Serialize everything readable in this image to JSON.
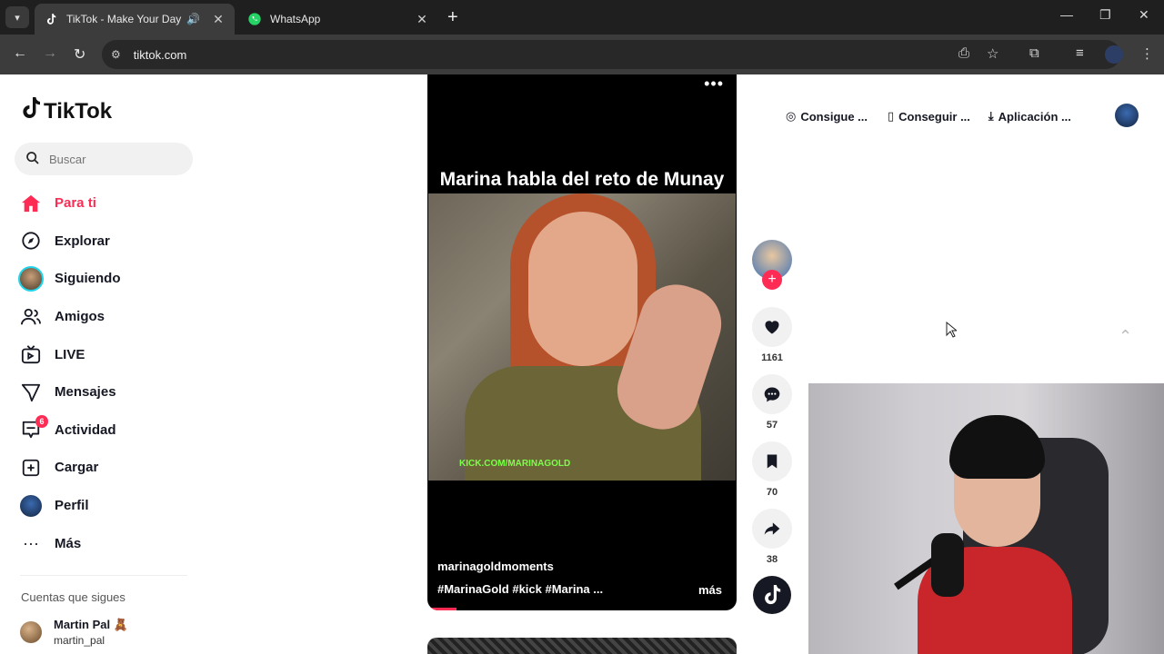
{
  "browser": {
    "tabs": [
      {
        "title": "TikTok - Make Your Day",
        "active": true
      },
      {
        "title": "WhatsApp",
        "active": false
      }
    ],
    "url": "tiktok.com"
  },
  "sidebar": {
    "logo": "TikTok",
    "search_placeholder": "Buscar",
    "items": [
      {
        "label": "Para ti",
        "icon": "home-icon"
      },
      {
        "label": "Explorar",
        "icon": "compass-icon"
      },
      {
        "label": "Siguiendo",
        "icon": "following-avatar-icon"
      },
      {
        "label": "Amigos",
        "icon": "friends-icon"
      },
      {
        "label": "LIVE",
        "icon": "live-icon"
      },
      {
        "label": "Mensajes",
        "icon": "send-icon"
      },
      {
        "label": "Actividad",
        "icon": "inbox-icon",
        "badge": "6"
      },
      {
        "label": "Cargar",
        "icon": "upload-icon"
      },
      {
        "label": "Perfil",
        "icon": "profile-avatar-icon"
      },
      {
        "label": "Más",
        "icon": "more-icon"
      }
    ],
    "following_title": "Cuentas que sigues",
    "following": [
      {
        "name": "Martin Pal 🧸",
        "handle": "martin_pal"
      }
    ]
  },
  "video": {
    "caption": "Marina habla del reto de Munay",
    "watermark": "KICK.COM/MARINAGOLD",
    "author": "marinagoldmoments",
    "tags": "#MarinaGold  #kick  #Marina  ...",
    "more": "más"
  },
  "actions": {
    "likes": "1161",
    "comments": "57",
    "saves": "70",
    "shares": "38"
  },
  "topbar": {
    "btn1": "Consigue ...",
    "btn2": "Conseguir ...",
    "btn3": "Aplicación ..."
  },
  "colors": {
    "accent": "#fe2c55",
    "chrome_dark": "#1f1f1f"
  }
}
